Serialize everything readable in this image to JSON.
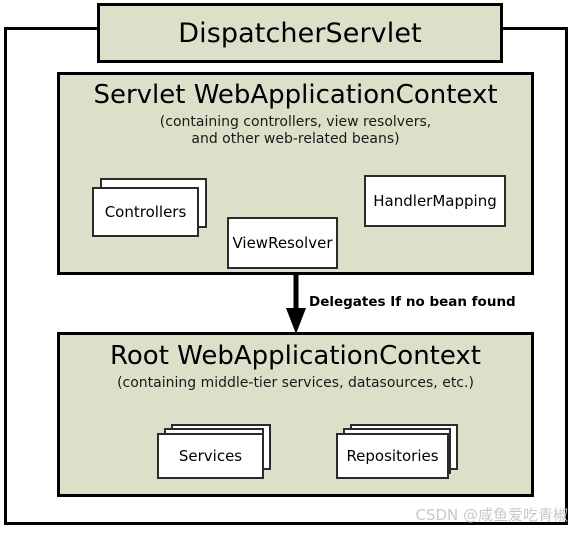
{
  "diagram": {
    "title": "DispatcherServlet",
    "servlet_context": {
      "title": "Servlet WebApplicationContext",
      "subtitle": "(containing controllers, view resolvers,\nand other web-related beans)",
      "beans": [
        {
          "label": "Controllers",
          "style": "stack"
        },
        {
          "label": "ViewResolver",
          "style": "single"
        },
        {
          "label": "HandlerMapping",
          "style": "single"
        }
      ]
    },
    "root_context": {
      "title": "Root WebApplicationContext",
      "subtitle": "(containing middle-tier services, datasources, etc.)",
      "beans": [
        {
          "label": "Services",
          "style": "stack"
        },
        {
          "label": "Repositories",
          "style": "stack"
        }
      ]
    },
    "arrow": {
      "label": "Delegates If no bean found",
      "direction": "down",
      "from": "Servlet WebApplicationContext",
      "to": "Root WebApplicationContext"
    },
    "watermark": "CSDN @咸鱼爱吃青椒",
    "colors": {
      "panel_fill": "#DCE0C9",
      "box_fill": "#FFFFFF",
      "stroke": "#000000",
      "watermark_text": "#C9C9C9",
      "page_background": "#FFFFFF"
    }
  }
}
